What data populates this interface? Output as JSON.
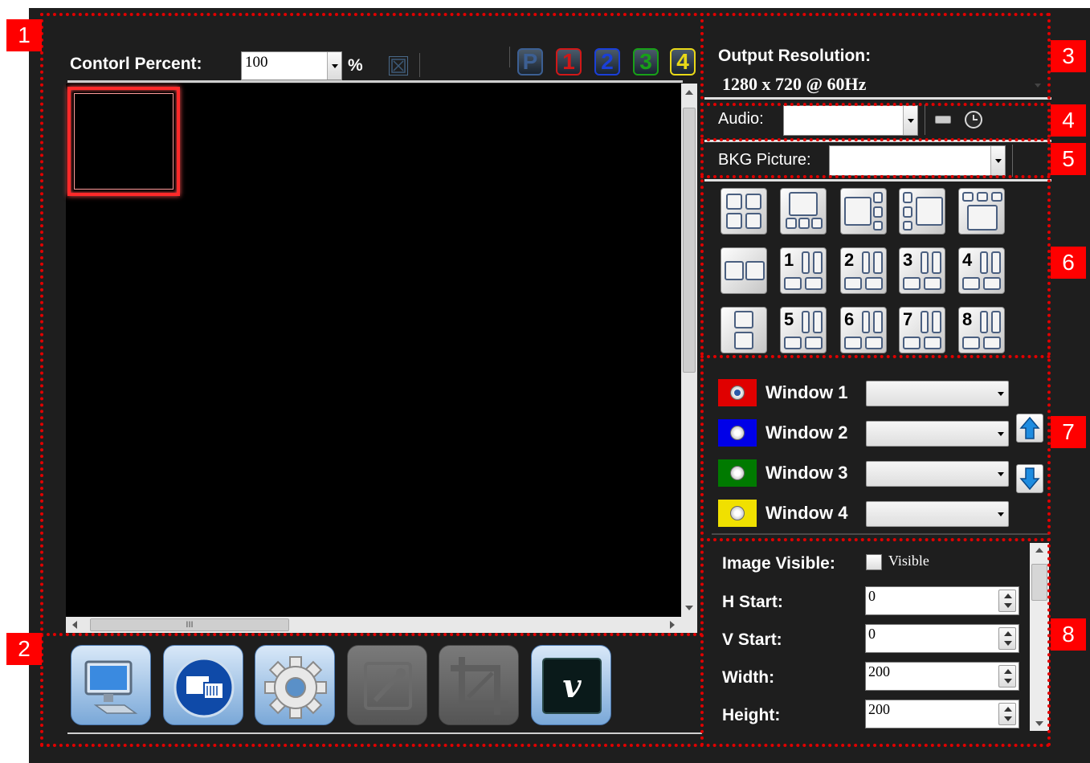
{
  "control": {
    "label": "Contorl Percent:",
    "value": "100",
    "unit": "%"
  },
  "preset_buttons": [
    {
      "label": "P",
      "color": "#3c5f93"
    },
    {
      "label": "1",
      "color": "#d01818"
    },
    {
      "label": "2",
      "color": "#1a3fd8"
    },
    {
      "label": "3",
      "color": "#18a018"
    },
    {
      "label": "4",
      "color": "#e8d818"
    }
  ],
  "output": {
    "label": "Output Resolution:",
    "value": "1280 x 720 @ 60Hz"
  },
  "audio": {
    "label": "Audio:",
    "value": ""
  },
  "bkg": {
    "label": "BKG Picture:",
    "value": ""
  },
  "layouts": {
    "row1": [
      {
        "icon": "layout-quad-icon",
        "num": ""
      },
      {
        "icon": "layout-big-3-bottom-icon",
        "num": ""
      },
      {
        "icon": "layout-big-3-right-icon",
        "num": ""
      },
      {
        "icon": "layout-3-left-big-icon",
        "num": ""
      },
      {
        "icon": "layout-3-top-big-icon",
        "num": ""
      }
    ],
    "row2": [
      {
        "icon": "layout-side-by-side-icon",
        "num": ""
      },
      {
        "icon": "layout-preset-icon",
        "num": "1"
      },
      {
        "icon": "layout-preset-icon",
        "num": "2"
      },
      {
        "icon": "layout-preset-icon",
        "num": "3"
      },
      {
        "icon": "layout-preset-icon",
        "num": "4"
      }
    ],
    "row3": [
      {
        "icon": "layout-stacked-icon",
        "num": ""
      },
      {
        "icon": "layout-preset-icon",
        "num": "5"
      },
      {
        "icon": "layout-preset-icon",
        "num": "6"
      },
      {
        "icon": "layout-preset-icon",
        "num": "7"
      },
      {
        "icon": "layout-preset-icon",
        "num": "8"
      }
    ]
  },
  "windows": [
    {
      "label": "Window 1",
      "color": "#e00000",
      "selected": true,
      "source": ""
    },
    {
      "label": "Window 2",
      "color": "#0000e8",
      "selected": false,
      "source": ""
    },
    {
      "label": "Window 3",
      "color": "#007a00",
      "selected": false,
      "source": ""
    },
    {
      "label": "Window 4",
      "color": "#f0e000",
      "selected": false,
      "source": ""
    }
  ],
  "props": {
    "image_visible_label": "Image Visible:",
    "visible_label": "Visible",
    "h_start_label": "H Start:",
    "h_start": "0",
    "v_start_label": "V Start:",
    "v_start": "0",
    "width_label": "Width:",
    "width": "200",
    "height_label": "Height:",
    "height": "200"
  },
  "toolbar": [
    {
      "icon": "monitor-icon",
      "enabled": true
    },
    {
      "icon": "input-source-icon",
      "enabled": true
    },
    {
      "icon": "gear-icon",
      "enabled": true
    },
    {
      "icon": "edit-pen-icon",
      "enabled": false
    },
    {
      "icon": "crop-icon",
      "enabled": false
    },
    {
      "icon": "vimeo-icon",
      "enabled": true
    }
  ],
  "callouts": [
    "1",
    "2",
    "3",
    "4",
    "5",
    "6",
    "7",
    "8"
  ],
  "scrollbar_grip": "III",
  "colors": {
    "bg": "#1e1e1e",
    "annotation": "#ff0000",
    "canvas": "#000000"
  }
}
